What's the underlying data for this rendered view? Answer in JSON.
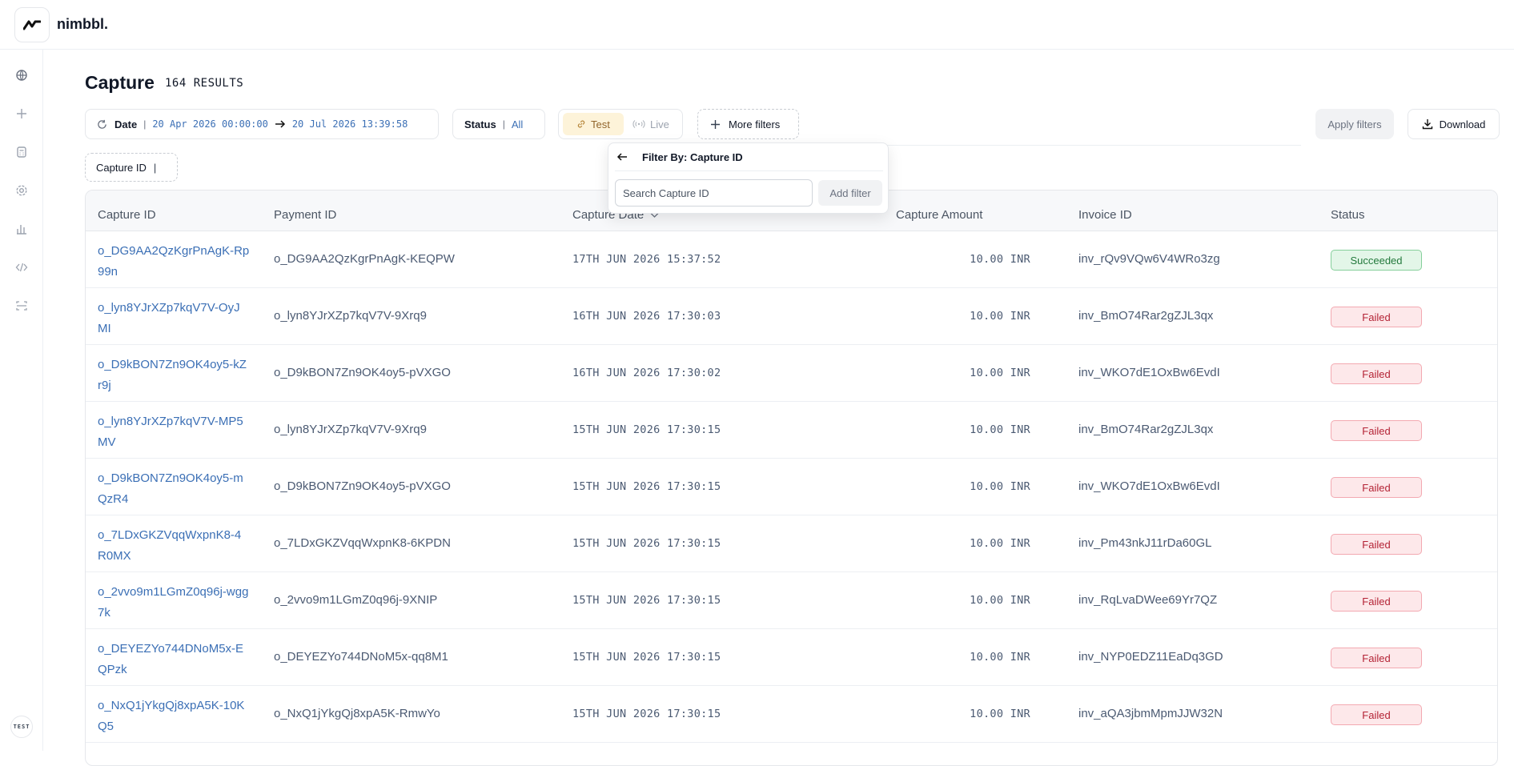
{
  "brand": {
    "name": "nimbbl."
  },
  "sidebar": {
    "items": [
      {
        "icon": "globe-icon"
      },
      {
        "icon": "plus-icon"
      },
      {
        "icon": "calculator-icon"
      },
      {
        "icon": "settings-icon"
      },
      {
        "icon": "bar-chart-icon"
      },
      {
        "icon": "code-icon"
      },
      {
        "icon": "scan-icon"
      }
    ],
    "mode_badge": "TEST"
  },
  "header": {
    "title": "Capture",
    "count": "164 RESULTS"
  },
  "filters": {
    "date_label": "Date",
    "date_separator": "|",
    "date_from": "20 Apr 2026 00:00:00",
    "date_to": "20 Jul 2026 13:39:58",
    "status_label": "Status",
    "status_separator": "|",
    "status_value": "All",
    "mode_test": "Test",
    "mode_live": "Live",
    "more_filters": "More filters",
    "apply": "Apply filters",
    "download": "Download",
    "capture_chip_label": "Capture ID",
    "capture_chip_sep": "|"
  },
  "popover": {
    "title": "Filter By: Capture ID",
    "placeholder": "Search Capture ID",
    "add_button": "Add filter"
  },
  "table": {
    "columns": [
      "Capture ID",
      "Payment ID",
      "Capture Date",
      "Capture Amount",
      "Invoice ID",
      "Status"
    ],
    "rows": [
      {
        "capture_id": "o_DG9AA2QzKgrPnAgK-Rp99n",
        "payment_id": "o_DG9AA2QzKgrPnAgK-KEQPW",
        "date": "17TH JUN 2026 15:37:52",
        "amount": "10.00 INR",
        "invoice_id": "inv_rQv9VQw6V4WRo3zg",
        "status": "Succeeded"
      },
      {
        "capture_id": "o_lyn8YJrXZp7kqV7V-OyJMI",
        "payment_id": "o_lyn8YJrXZp7kqV7V-9Xrq9",
        "date": "16TH JUN 2026 17:30:03",
        "amount": "10.00 INR",
        "invoice_id": "inv_BmO74Rar2gZJL3qx",
        "status": "Failed"
      },
      {
        "capture_id": "o_D9kBON7Zn9OK4oy5-kZr9j",
        "payment_id": "o_D9kBON7Zn9OK4oy5-pVXGO",
        "date": "16TH JUN 2026 17:30:02",
        "amount": "10.00 INR",
        "invoice_id": "inv_WKO7dE1OxBw6EvdI",
        "status": "Failed"
      },
      {
        "capture_id": "o_lyn8YJrXZp7kqV7V-MP5MV",
        "payment_id": "o_lyn8YJrXZp7kqV7V-9Xrq9",
        "date": "15TH JUN 2026 17:30:15",
        "amount": "10.00 INR",
        "invoice_id": "inv_BmO74Rar2gZJL3qx",
        "status": "Failed"
      },
      {
        "capture_id": "o_D9kBON7Zn9OK4oy5-mQzR4",
        "payment_id": "o_D9kBON7Zn9OK4oy5-pVXGO",
        "date": "15TH JUN 2026 17:30:15",
        "amount": "10.00 INR",
        "invoice_id": "inv_WKO7dE1OxBw6EvdI",
        "status": "Failed"
      },
      {
        "capture_id": "o_7LDxGKZVqqWxpnK8-4R0MX",
        "payment_id": "o_7LDxGKZVqqWxpnK8-6KPDN",
        "date": "15TH JUN 2026 17:30:15",
        "amount": "10.00 INR",
        "invoice_id": "inv_Pm43nkJ11rDa60GL",
        "status": "Failed"
      },
      {
        "capture_id": "o_2vvo9m1LGmZ0q96j-wgg7k",
        "payment_id": "o_2vvo9m1LGmZ0q96j-9XNIP",
        "date": "15TH JUN 2026 17:30:15",
        "amount": "10.00 INR",
        "invoice_id": "inv_RqLvaDWee69Yr7QZ",
        "status": "Failed"
      },
      {
        "capture_id": "o_DEYEZYo744DNoM5x-EQPzk",
        "payment_id": "o_DEYEZYo744DNoM5x-qq8M1",
        "date": "15TH JUN 2026 17:30:15",
        "amount": "10.00 INR",
        "invoice_id": "inv_NYP0EDZ11EaDq3GD",
        "status": "Failed"
      },
      {
        "capture_id": "o_NxQ1jYkgQj8xpA5K-10KQ5",
        "payment_id": "o_NxQ1jYkgQj8xpA5K-RmwYo",
        "date": "15TH JUN 2026 17:30:15",
        "amount": "10.00 INR",
        "invoice_id": "inv_aQA3jbmMpmJJW32N",
        "status": "Failed"
      }
    ]
  },
  "colors": {
    "link": "#3b6fb5",
    "failed": "#b42335",
    "succeeded": "#23793c",
    "test_bg": "#fdf3d9"
  }
}
